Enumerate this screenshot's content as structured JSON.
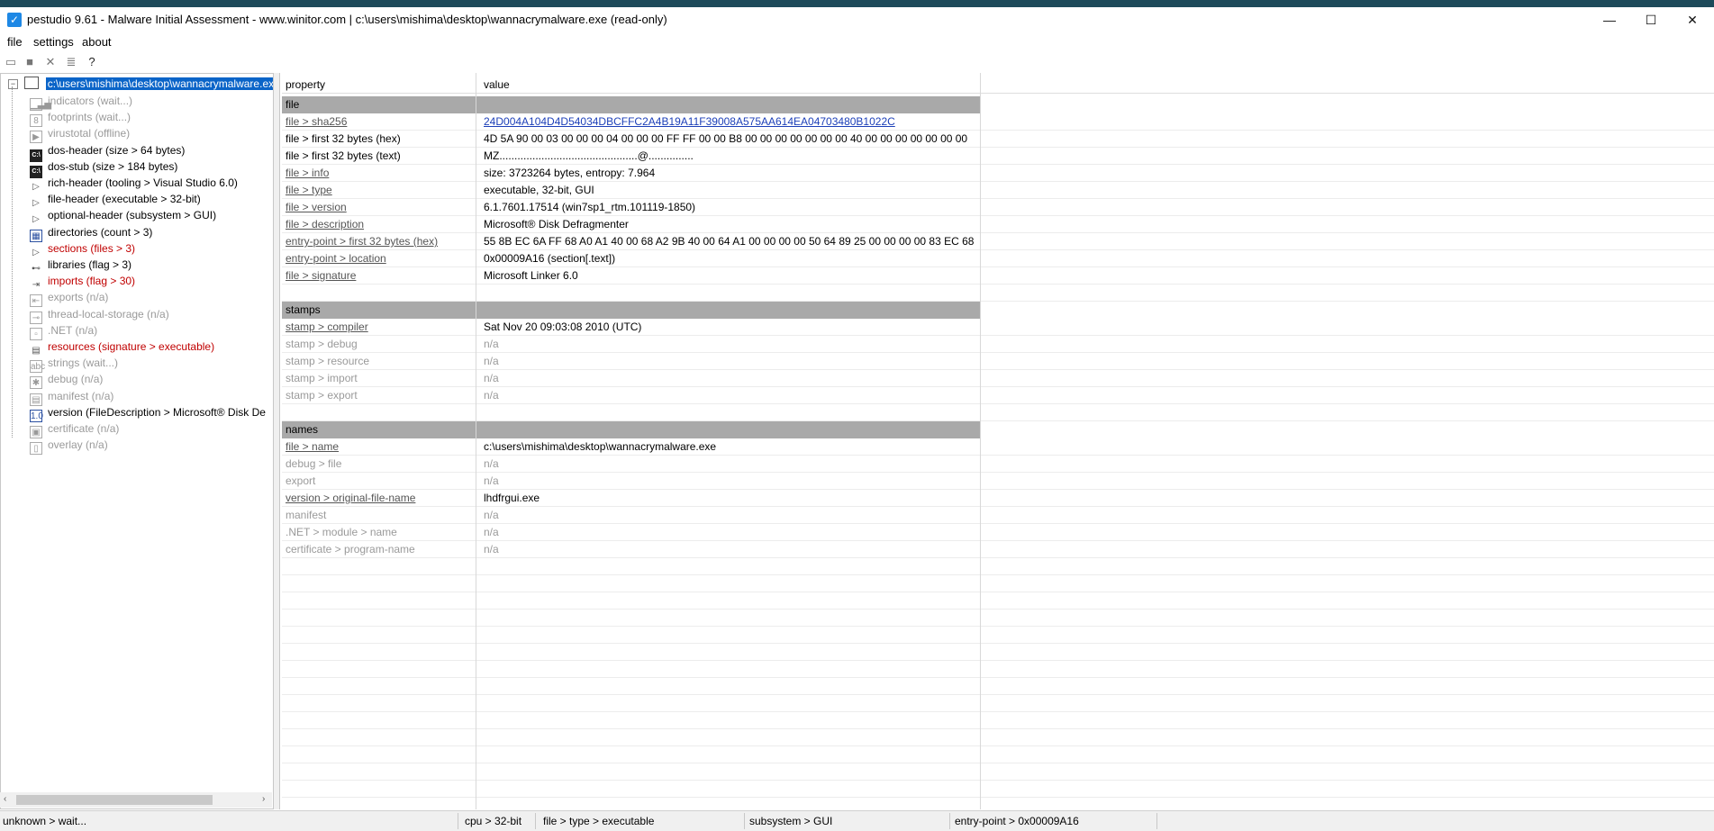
{
  "window": {
    "title": "pestudio 9.61 - Malware Initial Assessment - www.winitor.com | c:\\users\\mishima\\desktop\\wannacrymalware.exe (read-only)",
    "minimize": "—",
    "maximize": "☐",
    "close": "✕"
  },
  "menu": [
    "file",
    "settings",
    "about"
  ],
  "tree": {
    "root": "c:\\users\\mishima\\desktop\\wannacrymalware.exe",
    "items": [
      {
        "label": "indicators (wait...)",
        "style": "gray",
        "icon": "bars"
      },
      {
        "label": "footprints (wait...)",
        "style": "gray",
        "icon": "footprint"
      },
      {
        "label": "virustotal (offline)",
        "style": "gray",
        "icon": "arrow"
      },
      {
        "label": "dos-header (size > 64 bytes)",
        "style": "black",
        "icon": "dos"
      },
      {
        "label": "dos-stub (size > 184 bytes)",
        "style": "black",
        "icon": "dos"
      },
      {
        "label": "rich-header (tooling > Visual Studio 6.0)",
        "style": "black",
        "icon": "tri"
      },
      {
        "label": "file-header (executable > 32-bit)",
        "style": "black",
        "icon": "tri"
      },
      {
        "label": "optional-header (subsystem > GUI)",
        "style": "black",
        "icon": "tri"
      },
      {
        "label": "directories (count > 3)",
        "style": "black",
        "icon": "dir"
      },
      {
        "label": "sections (files > 3)",
        "style": "red",
        "icon": "tri"
      },
      {
        "label": "libraries (flag > 3)",
        "style": "black",
        "icon": "lib"
      },
      {
        "label": "imports (flag > 30)",
        "style": "red",
        "icon": "imp"
      },
      {
        "label": "exports (n/a)",
        "style": "gray",
        "icon": "exp"
      },
      {
        "label": "thread-local-storage (n/a)",
        "style": "gray",
        "icon": "tls"
      },
      {
        "label": ".NET (n/a)",
        "style": "gray",
        "icon": "net"
      },
      {
        "label": "resources (signature > executable)",
        "style": "red",
        "icon": "res"
      },
      {
        "label": "strings (wait...)",
        "style": "gray",
        "icon": "abc"
      },
      {
        "label": "debug (n/a)",
        "style": "gray",
        "icon": "bug"
      },
      {
        "label": "manifest (n/a)",
        "style": "gray",
        "icon": "man"
      },
      {
        "label": "version (FileDescription > Microsoft® Disk De",
        "style": "black",
        "icon": "ver"
      },
      {
        "label": "certificate (n/a)",
        "style": "gray",
        "icon": "cert"
      },
      {
        "label": "overlay (n/a)",
        "style": "gray",
        "icon": "page"
      }
    ]
  },
  "table": {
    "headers": {
      "property": "property",
      "value": "value"
    },
    "rows": [
      {
        "type": "section",
        "p": "file",
        "v": ""
      },
      {
        "type": "link",
        "p": "file > sha256",
        "v": "24D004A104D4D54034DBCFFC2A4B19A11F39008A575AA614EA04703480B1022C",
        "pu": true
      },
      {
        "type": "normal",
        "p": "file > first 32 bytes (hex)",
        "v": "4D 5A 90 00 03 00 00 00 04 00 00 00 FF FF 00 00 B8 00 00 00 00 00 00 00 40 00 00 00 00 00 00 00"
      },
      {
        "type": "normal",
        "p": "file > first 32 bytes (text)",
        "v": "MZ..............................................@..............."
      },
      {
        "type": "normal",
        "p": "file > info",
        "v": "size: 3723264 bytes, entropy: 7.964",
        "pu": true
      },
      {
        "type": "normal",
        "p": "file > type",
        "v": "executable, 32-bit, GUI",
        "pu": true
      },
      {
        "type": "normal",
        "p": "file > version",
        "v": "6.1.7601.17514 (win7sp1_rtm.101119-1850)",
        "pu": true
      },
      {
        "type": "normal",
        "p": "file > description",
        "v": "Microsoft® Disk Defragmenter",
        "pu": true
      },
      {
        "type": "normal",
        "p": "entry-point > first 32 bytes (hex)",
        "v": "55 8B EC 6A FF 68 A0 A1 40 00 68 A2 9B 40 00 64 A1 00 00 00 00 50 64 89 25 00 00 00 00 83 EC 68",
        "pu": true
      },
      {
        "type": "normal",
        "p": "entry-point > location",
        "v": "0x00009A16 (section[.text])",
        "pu": true
      },
      {
        "type": "normal",
        "p": "file > signature",
        "v": "Microsoft Linker 6.0",
        "pu": true
      },
      {
        "type": "blank",
        "p": "",
        "v": ""
      },
      {
        "type": "section",
        "p": "stamps",
        "v": ""
      },
      {
        "type": "normal",
        "p": "stamp > compiler",
        "v": "Sat Nov 20 09:03:08 2010 (UTC)",
        "pu": true
      },
      {
        "type": "gray",
        "p": "stamp > debug",
        "v": "n/a"
      },
      {
        "type": "gray",
        "p": "stamp > resource",
        "v": "n/a"
      },
      {
        "type": "gray",
        "p": "stamp > import",
        "v": "n/a"
      },
      {
        "type": "gray",
        "p": "stamp > export",
        "v": "n/a"
      },
      {
        "type": "blank",
        "p": "",
        "v": ""
      },
      {
        "type": "section",
        "p": "names",
        "v": ""
      },
      {
        "type": "normal",
        "p": "file > name",
        "v": "c:\\users\\mishima\\desktop\\wannacrymalware.exe",
        "pu": true
      },
      {
        "type": "gray",
        "p": "debug > file",
        "v": "n/a"
      },
      {
        "type": "gray",
        "p": "export",
        "v": "n/a"
      },
      {
        "type": "normal",
        "p": "version > original-file-name",
        "v": "lhdfrgui.exe",
        "pu": true
      },
      {
        "type": "gray",
        "p": "manifest",
        "v": "n/a"
      },
      {
        "type": "gray",
        "p": ".NET > module > name",
        "v": "n/a"
      },
      {
        "type": "gray",
        "p": "certificate > program-name",
        "v": "n/a"
      }
    ]
  },
  "status": [
    "unknown > wait...",
    "cpu > 32-bit",
    "file > type > executable",
    "subsystem > GUI",
    "entry-point > 0x00009A16"
  ]
}
